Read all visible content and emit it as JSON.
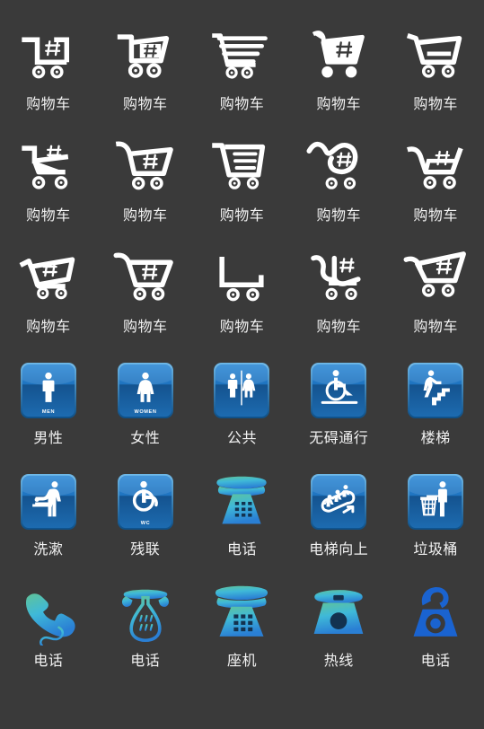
{
  "page": {
    "background_color": "#3a3a3a",
    "label_color": "#f2f2f2",
    "columns": 5,
    "rows": 6,
    "blue_tile_color": "#1b72c4",
    "blue_tile_color_dark": "#12538f",
    "blue_flat_color": "#1a63d0",
    "phone_gradient_start": "#5fc39a",
    "phone_gradient_mid": "#3fb9d8",
    "phone_gradient_end": "#2a7fd4"
  },
  "icons": [
    {
      "id": "cart-01",
      "label": "购物车",
      "icon_name": "shopping-cart-square-outline-icon",
      "style": "white-line",
      "row": 1,
      "col": 1
    },
    {
      "id": "cart-02",
      "label": "购物车",
      "icon_name": "shopping-cart-hash-basket-icon",
      "style": "white-line",
      "row": 1,
      "col": 2
    },
    {
      "id": "cart-03",
      "label": "购物车",
      "icon_name": "shopping-cart-striped-icon",
      "style": "white-line",
      "row": 1,
      "col": 3
    },
    {
      "id": "cart-04",
      "label": "购物车",
      "icon_name": "shopping-cart-solid-hash-icon",
      "style": "white-line",
      "row": 1,
      "col": 4
    },
    {
      "id": "cart-05",
      "label": "购物车",
      "icon_name": "shopping-cart-open-outline-icon",
      "style": "white-line",
      "row": 1,
      "col": 5
    },
    {
      "id": "cart-06",
      "label": "购物车",
      "icon_name": "shopping-cart-angled-hash-icon",
      "style": "white-line",
      "row": 2,
      "col": 1
    },
    {
      "id": "cart-07",
      "label": "购物车",
      "icon_name": "shopping-cart-classic-hash-icon",
      "style": "white-line",
      "row": 2,
      "col": 2
    },
    {
      "id": "cart-08",
      "label": "购物车",
      "icon_name": "shopping-cart-lines-box-icon",
      "style": "white-line",
      "row": 2,
      "col": 3
    },
    {
      "id": "cart-09",
      "label": "购物车",
      "icon_name": "shopping-cart-wave-handle-icon",
      "style": "white-line",
      "row": 2,
      "col": 4
    },
    {
      "id": "cart-10",
      "label": "购物车",
      "icon_name": "shopping-cart-thin-hash-icon",
      "style": "white-line",
      "row": 2,
      "col": 5
    },
    {
      "id": "cart-11",
      "label": "购物车",
      "icon_name": "shopping-cart-tilted-hash-icon",
      "style": "white-line",
      "row": 3,
      "col": 1
    },
    {
      "id": "cart-12",
      "label": "购物车",
      "icon_name": "shopping-cart-trapezoid-hash-icon",
      "style": "white-line",
      "row": 3,
      "col": 2
    },
    {
      "id": "cart-13",
      "label": "购物车",
      "icon_name": "shopping-cart-minimal-icon",
      "style": "white-line",
      "row": 3,
      "col": 3
    },
    {
      "id": "cart-14",
      "label": "购物车",
      "icon_name": "shopping-cart-curled-hash-icon",
      "style": "white-line",
      "row": 3,
      "col": 4
    },
    {
      "id": "cart-15",
      "label": "购物车",
      "icon_name": "shopping-cart-wide-hash-icon",
      "style": "white-line",
      "row": 3,
      "col": 5
    },
    {
      "id": "sign-men",
      "label": "男性",
      "icon_name": "restroom-men-icon",
      "style": "blue-tile",
      "badge": "MEN",
      "row": 4,
      "col": 1
    },
    {
      "id": "sign-women",
      "label": "女性",
      "icon_name": "restroom-women-icon",
      "style": "blue-tile",
      "badge": "WOMEN",
      "row": 4,
      "col": 2
    },
    {
      "id": "sign-public",
      "label": "公共",
      "icon_name": "restroom-unisex-icon",
      "style": "blue-tile",
      "badge": "",
      "row": 4,
      "col": 3
    },
    {
      "id": "sign-accessible",
      "label": "无碍通行",
      "icon_name": "wheelchair-ramp-icon",
      "style": "blue-tile",
      "badge": "",
      "row": 4,
      "col": 4
    },
    {
      "id": "sign-stairs",
      "label": "楼梯",
      "icon_name": "stairs-icon",
      "style": "blue-tile",
      "badge": "",
      "row": 4,
      "col": 5
    },
    {
      "id": "sign-babychange",
      "label": "洗漱",
      "icon_name": "baby-changing-station-icon",
      "style": "blue-tile",
      "badge": "",
      "row": 5,
      "col": 1
    },
    {
      "id": "sign-wc",
      "label": "残联",
      "icon_name": "wheelchair-wc-icon",
      "style": "blue-tile",
      "badge": "WC",
      "row": 5,
      "col": 2
    },
    {
      "id": "phone-desk-a",
      "label": "电话",
      "icon_name": "desk-telephone-gradient-icon",
      "style": "gradient",
      "row": 5,
      "col": 3
    },
    {
      "id": "sign-escalator-up",
      "label": "电梯向上",
      "icon_name": "escalator-up-icon",
      "style": "blue-tile",
      "badge": "",
      "row": 5,
      "col": 4
    },
    {
      "id": "sign-trash",
      "label": "垃圾桶",
      "icon_name": "litter-bin-icon",
      "style": "blue-tile",
      "badge": "",
      "row": 5,
      "col": 5
    },
    {
      "id": "phone-handset",
      "label": "电话",
      "icon_name": "phone-handset-cord-gradient-icon",
      "style": "gradient",
      "row": 6,
      "col": 1
    },
    {
      "id": "phone-candlestick",
      "label": "电话",
      "icon_name": "vintage-telephone-gradient-icon",
      "style": "gradient",
      "row": 6,
      "col": 2
    },
    {
      "id": "phone-desk-b",
      "label": "座机",
      "icon_name": "landline-telephone-gradient-icon",
      "style": "gradient",
      "row": 6,
      "col": 3
    },
    {
      "id": "phone-rotary",
      "label": "热线",
      "icon_name": "hotline-telephone-gradient-icon",
      "style": "gradient",
      "row": 6,
      "col": 4
    },
    {
      "id": "phone-flat-blue",
      "label": "电话",
      "icon_name": "telephone-flat-blue-icon",
      "style": "flat-blue",
      "row": 6,
      "col": 5
    }
  ]
}
